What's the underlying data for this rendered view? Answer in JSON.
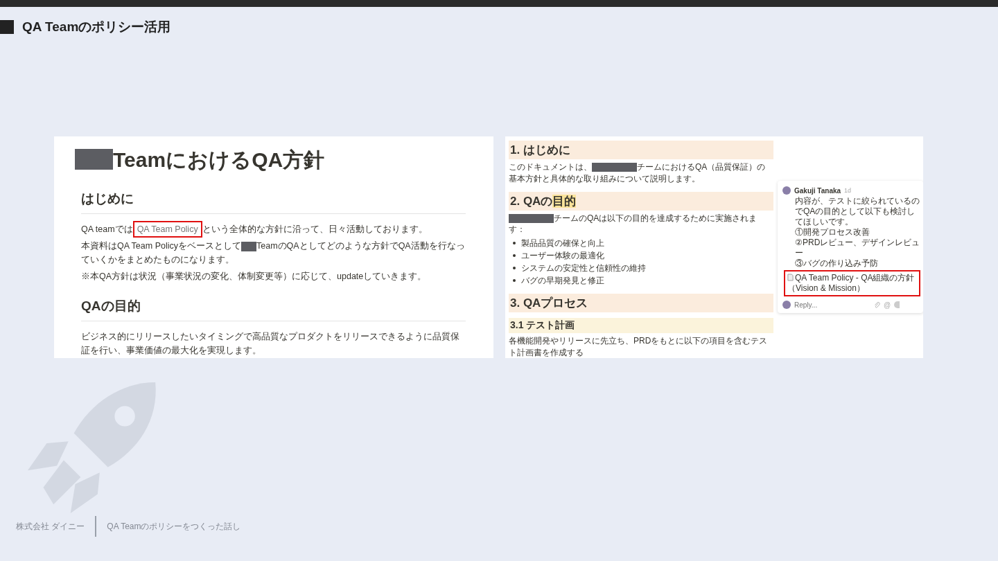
{
  "slide": {
    "title": "QA Teamのポリシー活用"
  },
  "left_doc": {
    "title": [
      {
        "kind": "redacted"
      },
      {
        "kind": "text",
        "text": "TeamにおけるQA方針"
      }
    ],
    "sections": [
      {
        "heading": "はじめに",
        "paragraphs": [
          [
            {
              "kind": "text",
              "text": "QA teamでは"
            },
            {
              "kind": "link",
              "text": "QA Team Policy",
              "highlighted": true
            },
            {
              "kind": "text",
              "text": "という全体的な方針に沿って、日々活動しております。"
            }
          ],
          [
            {
              "kind": "text",
              "text": "本資料はQA Team Policyをベースとして"
            },
            {
              "kind": "redacted"
            },
            {
              "kind": "text",
              "text": "TeamのQAとしてどのような方針でQA活動を行なっていくかをまとめたものになります。"
            }
          ],
          [
            {
              "kind": "text",
              "text": "※本QA方針は状況（事業状況の変化、体制変更等）に応じて、updateしていきます。"
            }
          ]
        ]
      },
      {
        "heading": "QAの目的",
        "paragraphs": [
          [
            {
              "kind": "text",
              "text": "ビジネス的にリリースしたいタイミングで高品質なプロダクトをリリースできるように品質保証を行い、事業価値の最大化を実現します。"
            }
          ]
        ]
      }
    ]
  },
  "right_doc": {
    "blocks": [
      {
        "kind": "h1",
        "parts": [
          {
            "kind": "text",
            "text": "1. はじめに"
          }
        ]
      },
      {
        "kind": "paragraph",
        "parts": [
          {
            "kind": "text",
            "text": "このドキュメントは、"
          },
          {
            "kind": "redacted"
          },
          {
            "kind": "text",
            "text": "チームにおけるQA（品質保証）の基本方針と具体的な取り組みについて説明します。"
          }
        ]
      },
      {
        "kind": "h1",
        "parts": [
          {
            "kind": "text",
            "text": "2. QAの"
          },
          {
            "kind": "highlight",
            "text": "目的"
          }
        ]
      },
      {
        "kind": "paragraph",
        "parts": [
          {
            "kind": "redacted"
          },
          {
            "kind": "text",
            "text": "チームのQAは以下の目的を達成するために実施されます："
          }
        ]
      },
      {
        "kind": "bullets",
        "items": [
          "製品品質の確保と向上",
          "ユーザー体験の最適化",
          "システムの安定性と信頼性の維持",
          "バグの早期発見と修正"
        ]
      },
      {
        "kind": "h1",
        "parts": [
          {
            "kind": "text",
            "text": "3. QAプロセス"
          }
        ]
      },
      {
        "kind": "h2",
        "parts": [
          {
            "kind": "text",
            "text": "3.1 テスト計画"
          }
        ]
      },
      {
        "kind": "paragraph",
        "parts": [
          {
            "kind": "text",
            "text": "各機能開発やリリースに先立ち、PRDをもとに以下の項目を含むテスト計画書を作成する"
          }
        ]
      }
    ],
    "comment": {
      "author": "Gakuji Tanaka",
      "time": "1d",
      "lines": [
        "内容が、テストに絞られているのでQAの目的として以下も検討してほしいです。",
        "①開発プロセス改善",
        "②PRDレビュー、デザインレビュー",
        "③バグの作り込み予防"
      ],
      "mention": {
        "text": "QA Team Policy - QA組織の方針（Vision & Mission）",
        "highlighted": true
      },
      "reply": {
        "placeholder": "Reply...",
        "mention_button": "@"
      }
    }
  },
  "footer": {
    "company": "株式会社 ダイニー",
    "deck_title": "QA Teamのポリシーをつくった話し"
  }
}
